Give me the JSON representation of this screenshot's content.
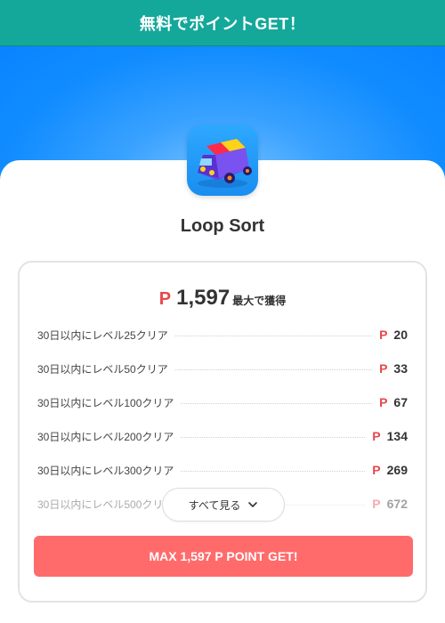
{
  "header": {
    "title": "無料でポイントGET！"
  },
  "app": {
    "name": "Loop Sort"
  },
  "points": {
    "currency_symbol": "P",
    "total": "1,597",
    "total_suffix": "最大で獲得"
  },
  "rewards": [
    {
      "label": "30日以内にレベル25クリア",
      "points": "20"
    },
    {
      "label": "30日以内にレベル50クリア",
      "points": "33"
    },
    {
      "label": "30日以内にレベル100クリア",
      "points": "67"
    },
    {
      "label": "30日以内にレベル200クリア",
      "points": "134"
    },
    {
      "label": "30日以内にレベル300クリア",
      "points": "269"
    },
    {
      "label": "30日以内にレベル500クリア",
      "points": "672"
    }
  ],
  "see_all": {
    "label": "すべて見る",
    "icon": "chevron-down-icon"
  },
  "cta": {
    "label": "MAX 1,597 P POINT GET!"
  },
  "colors": {
    "header": "#14a89a",
    "hero": "#0a84ff",
    "points_accent": "#e8474d",
    "cta": "#ff6b6b"
  }
}
